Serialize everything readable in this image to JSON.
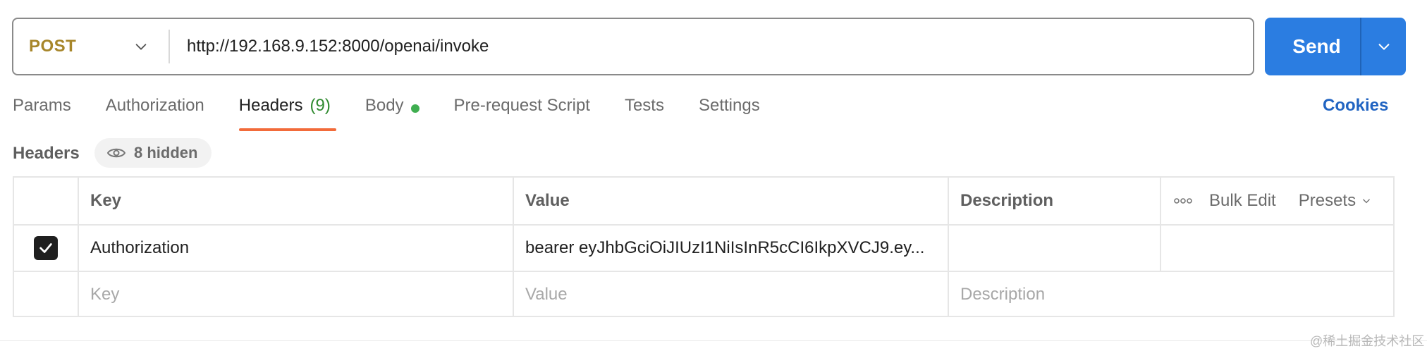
{
  "request": {
    "method": "POST",
    "url": "http://192.168.9.152:8000/openai/invoke",
    "send_label": "Send"
  },
  "tabs": [
    {
      "label": "Params"
    },
    {
      "label": "Authorization"
    },
    {
      "label": "Headers",
      "count": "(9)",
      "active": true
    },
    {
      "label": "Body",
      "has_dot": true
    },
    {
      "label": "Pre-request Script"
    },
    {
      "label": "Tests"
    },
    {
      "label": "Settings"
    }
  ],
  "cookies_label": "Cookies",
  "headers_section": {
    "title": "Headers",
    "hidden_label": "8 hidden"
  },
  "table": {
    "columns": {
      "key": "Key",
      "value": "Value",
      "description": "Description"
    },
    "actions": {
      "bulk_edit": "Bulk Edit",
      "presets": "Presets"
    },
    "rows": [
      {
        "checked": true,
        "key": "Authorization",
        "value": "bearer eyJhbGciOiJIUzI1NiIsInR5cCI6IkpXVCJ9.ey...",
        "description": ""
      }
    ],
    "placeholders": {
      "key": "Key",
      "value": "Value",
      "description": "Description"
    }
  },
  "watermark": "@稀土掘金技术社区",
  "colors": {
    "method": "#a7862a",
    "send": "#2b7de1",
    "active_tab_underline": "#f26b3a",
    "count": "#2f8a2f",
    "body_dot": "#3fae50",
    "cookies": "#2164c2"
  }
}
